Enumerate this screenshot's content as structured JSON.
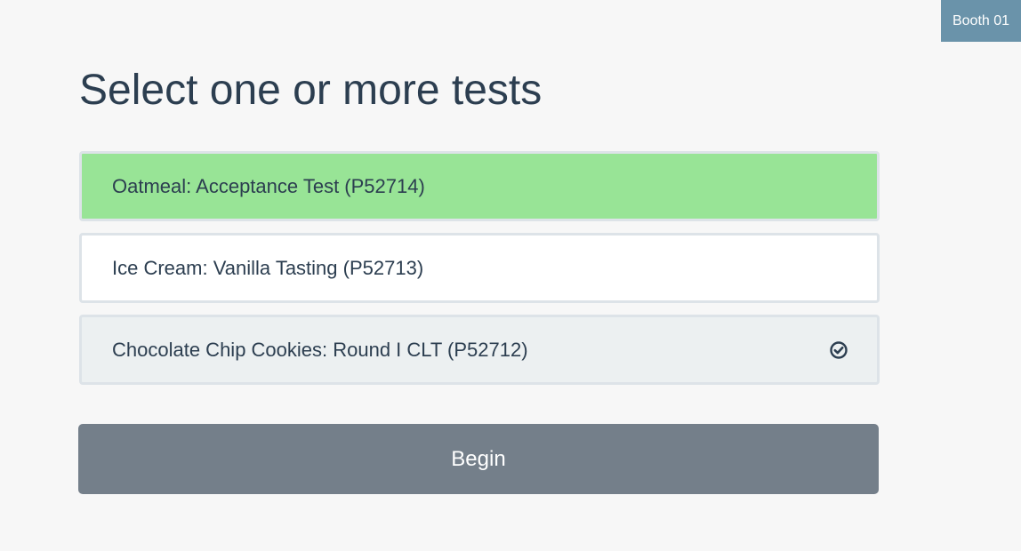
{
  "booth": {
    "label": "Booth 01",
    "color": "#6a93aa"
  },
  "page": {
    "title": "Select one or more tests"
  },
  "tests": [
    {
      "label": "Oatmeal: Acceptance Test (P52714)",
      "state": "selected",
      "color": "#98e496"
    },
    {
      "label": "Ice Cream: Vanilla Tasting (P52713)",
      "state": "default",
      "color": "#ffffff"
    },
    {
      "label": "Chocolate Chip Cookies: Round I CLT (P52712)",
      "state": "completed",
      "color": "#ecf0f1",
      "icon": "check-circle-icon"
    }
  ],
  "actions": {
    "begin_label": "Begin",
    "begin_color": "#747f8a"
  }
}
